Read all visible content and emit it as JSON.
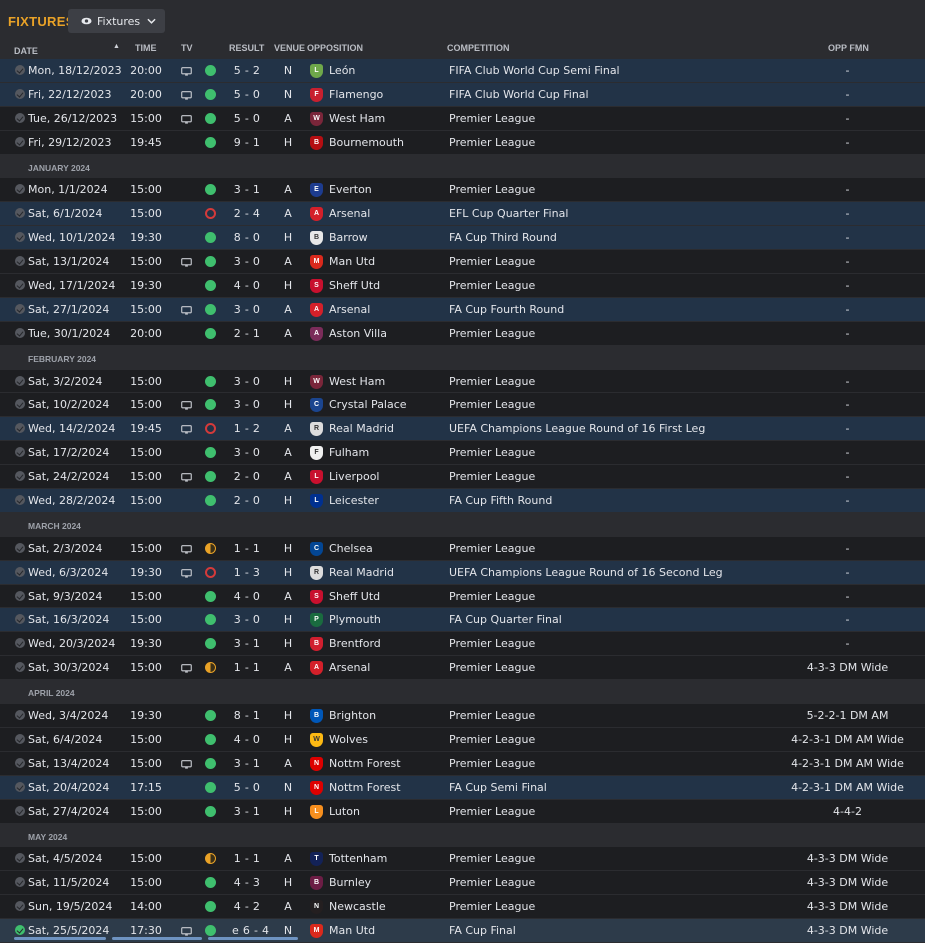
{
  "header": {
    "title": "FIXTURES",
    "view_label": "Fixtures"
  },
  "columns": {
    "date": "DATE",
    "time": "TIME",
    "tv": "TV",
    "result": "RESULT",
    "venue": "VENUE",
    "opposition": "OPPOSITION",
    "competition": "COMPETITION",
    "opp_fmn": "OPP FMN"
  },
  "colors": {
    "accent": "#e9a227",
    "win": "#3fbf6e",
    "loss": "#d43a3a",
    "draw": "#e9a227",
    "cup_row": "#223347"
  },
  "fixtures": [
    {
      "type": "match",
      "date": "Mon, 18/12/2023",
      "time": "20:00",
      "tv": true,
      "outcome": "W",
      "result": "5 - 2",
      "venue": "N",
      "opposition": "León",
      "competition": "FIFA Club World Cup Semi Final",
      "opp_fmn": "-",
      "style": "cup",
      "crest": "#6fa84a",
      "crest_text": "L"
    },
    {
      "type": "match",
      "date": "Fri, 22/12/2023",
      "time": "20:00",
      "tv": true,
      "outcome": "W",
      "result": "5 - 0",
      "venue": "N",
      "opposition": "Flamengo",
      "competition": "FIFA Club World Cup Final",
      "opp_fmn": "-",
      "style": "cup",
      "crest": "#c8202f",
      "crest_text": "F"
    },
    {
      "type": "match",
      "date": "Tue, 26/12/2023",
      "time": "15:00",
      "tv": true,
      "outcome": "W",
      "result": "5 - 0",
      "venue": "A",
      "opposition": "West Ham",
      "competition": "Premier League",
      "opp_fmn": "-",
      "style": "plain",
      "crest": "#7a263a",
      "crest_text": "W"
    },
    {
      "type": "match",
      "date": "Fri, 29/12/2023",
      "time": "19:45",
      "tv": false,
      "outcome": "W",
      "result": "9 - 1",
      "venue": "H",
      "opposition": "Bournemouth",
      "competition": "Premier League",
      "opp_fmn": "-",
      "style": "plain",
      "crest": "#b50e12",
      "crest_text": "B"
    },
    {
      "type": "month",
      "label": "JANUARY 2024"
    },
    {
      "type": "match",
      "date": "Mon, 1/1/2024",
      "time": "15:00",
      "tv": false,
      "outcome": "W",
      "result": "3 - 1",
      "venue": "A",
      "opposition": "Everton",
      "competition": "Premier League",
      "opp_fmn": "-",
      "style": "plain",
      "crest": "#1d3c8f",
      "crest_text": "E"
    },
    {
      "type": "match",
      "date": "Sat, 6/1/2024",
      "time": "15:00",
      "tv": false,
      "outcome": "L",
      "result": "2 - 4",
      "venue": "A",
      "opposition": "Arsenal",
      "competition": "EFL Cup Quarter Final",
      "opp_fmn": "-",
      "style": "cup",
      "crest": "#d4202a",
      "crest_text": "A"
    },
    {
      "type": "match",
      "date": "Wed, 10/1/2024",
      "time": "19:30",
      "tv": false,
      "outcome": "W",
      "result": "8 - 0",
      "venue": "H",
      "opposition": "Barrow",
      "competition": "FA Cup Third Round",
      "opp_fmn": "-",
      "style": "cup",
      "crest": "#e8e8e8",
      "crest_text": "B"
    },
    {
      "type": "match",
      "date": "Sat, 13/1/2024",
      "time": "15:00",
      "tv": true,
      "outcome": "W",
      "result": "3 - 0",
      "venue": "A",
      "opposition": "Man Utd",
      "competition": "Premier League",
      "opp_fmn": "-",
      "style": "plain",
      "crest": "#da291c",
      "crest_text": "M"
    },
    {
      "type": "match",
      "date": "Wed, 17/1/2024",
      "time": "19:30",
      "tv": false,
      "outcome": "W",
      "result": "4 - 0",
      "venue": "H",
      "opposition": "Sheff Utd",
      "competition": "Premier League",
      "opp_fmn": "-",
      "style": "plain",
      "crest": "#c8102e",
      "crest_text": "S"
    },
    {
      "type": "match",
      "date": "Sat, 27/1/2024",
      "time": "15:00",
      "tv": true,
      "outcome": "W",
      "result": "3 - 0",
      "venue": "A",
      "opposition": "Arsenal",
      "competition": "FA Cup Fourth Round",
      "opp_fmn": "-",
      "style": "cup",
      "crest": "#d4202a",
      "crest_text": "A"
    },
    {
      "type": "match",
      "date": "Tue, 30/1/2024",
      "time": "20:00",
      "tv": false,
      "outcome": "W",
      "result": "2 - 1",
      "venue": "A",
      "opposition": "Aston Villa",
      "competition": "Premier League",
      "opp_fmn": "-",
      "style": "plain",
      "crest": "#7b2c5a",
      "crest_text": "A"
    },
    {
      "type": "month",
      "label": "FEBRUARY 2024"
    },
    {
      "type": "match",
      "date": "Sat, 3/2/2024",
      "time": "15:00",
      "tv": false,
      "outcome": "W",
      "result": "3 - 0",
      "venue": "H",
      "opposition": "West Ham",
      "competition": "Premier League",
      "opp_fmn": "-",
      "style": "plain",
      "crest": "#7a263a",
      "crest_text": "W"
    },
    {
      "type": "match",
      "date": "Sat, 10/2/2024",
      "time": "15:00",
      "tv": true,
      "outcome": "W",
      "result": "3 - 0",
      "venue": "H",
      "opposition": "Crystal Palace",
      "competition": "Premier League",
      "opp_fmn": "-",
      "style": "plain",
      "crest": "#1b458f",
      "crest_text": "C"
    },
    {
      "type": "match",
      "date": "Wed, 14/2/2024",
      "time": "19:45",
      "tv": true,
      "outcome": "L",
      "result": "1 - 2",
      "venue": "A",
      "opposition": "Real Madrid",
      "competition": "UEFA Champions League Round of 16 First Leg",
      "opp_fmn": "-",
      "style": "cup",
      "crest": "#dcdcdc",
      "crest_text": "R"
    },
    {
      "type": "match",
      "date": "Sat, 17/2/2024",
      "time": "15:00",
      "tv": false,
      "outcome": "W",
      "result": "3 - 0",
      "venue": "A",
      "opposition": "Fulham",
      "competition": "Premier League",
      "opp_fmn": "-",
      "style": "plain",
      "crest": "#f0f0f0",
      "crest_text": "F"
    },
    {
      "type": "match",
      "date": "Sat, 24/2/2024",
      "time": "15:00",
      "tv": true,
      "outcome": "W",
      "result": "2 - 0",
      "venue": "A",
      "opposition": "Liverpool",
      "competition": "Premier League",
      "opp_fmn": "-",
      "style": "plain",
      "crest": "#c8102e",
      "crest_text": "L"
    },
    {
      "type": "match",
      "date": "Wed, 28/2/2024",
      "time": "15:00",
      "tv": false,
      "outcome": "W",
      "result": "2 - 0",
      "venue": "H",
      "opposition": "Leicester",
      "competition": "FA Cup Fifth Round",
      "opp_fmn": "-",
      "style": "cup",
      "crest": "#003090",
      "crest_text": "L"
    },
    {
      "type": "month",
      "label": "MARCH 2024"
    },
    {
      "type": "match",
      "date": "Sat, 2/3/2024",
      "time": "15:00",
      "tv": true,
      "outcome": "D",
      "result": "1 - 1",
      "venue": "H",
      "opposition": "Chelsea",
      "competition": "Premier League",
      "opp_fmn": "-",
      "style": "plain",
      "crest": "#034694",
      "crest_text": "C"
    },
    {
      "type": "match",
      "date": "Wed, 6/3/2024",
      "time": "19:30",
      "tv": true,
      "outcome": "L",
      "result": "1 - 3",
      "venue": "H",
      "opposition": "Real Madrid",
      "competition": "UEFA Champions League Round of 16 Second Leg",
      "opp_fmn": "-",
      "style": "cup",
      "crest": "#dcdcdc",
      "crest_text": "R"
    },
    {
      "type": "match",
      "date": "Sat, 9/3/2024",
      "time": "15:00",
      "tv": false,
      "outcome": "W",
      "result": "4 - 0",
      "venue": "A",
      "opposition": "Sheff Utd",
      "competition": "Premier League",
      "opp_fmn": "-",
      "style": "plain",
      "crest": "#c8102e",
      "crest_text": "S"
    },
    {
      "type": "match",
      "date": "Sat, 16/3/2024",
      "time": "15:00",
      "tv": false,
      "outcome": "W",
      "result": "3 - 0",
      "venue": "H",
      "opposition": "Plymouth",
      "competition": "FA Cup Quarter Final",
      "opp_fmn": "-",
      "style": "cup",
      "crest": "#1a6b3f",
      "crest_text": "P"
    },
    {
      "type": "match",
      "date": "Wed, 20/3/2024",
      "time": "19:30",
      "tv": false,
      "outcome": "W",
      "result": "3 - 1",
      "venue": "H",
      "opposition": "Brentford",
      "competition": "Premier League",
      "opp_fmn": "-",
      "style": "plain",
      "crest": "#d11f2f",
      "crest_text": "B"
    },
    {
      "type": "match",
      "date": "Sat, 30/3/2024",
      "time": "15:00",
      "tv": true,
      "outcome": "D",
      "result": "1 - 1",
      "venue": "A",
      "opposition": "Arsenal",
      "competition": "Premier League",
      "opp_fmn": "4-3-3 DM Wide",
      "style": "plain",
      "crest": "#d4202a",
      "crest_text": "A"
    },
    {
      "type": "month",
      "label": "APRIL 2024"
    },
    {
      "type": "match",
      "date": "Wed, 3/4/2024",
      "time": "19:30",
      "tv": false,
      "outcome": "W",
      "result": "8 - 1",
      "venue": "H",
      "opposition": "Brighton",
      "competition": "Premier League",
      "opp_fmn": "5-2-2-1 DM AM",
      "style": "plain",
      "crest": "#0057b8",
      "crest_text": "B"
    },
    {
      "type": "match",
      "date": "Sat, 6/4/2024",
      "time": "15:00",
      "tv": false,
      "outcome": "W",
      "result": "4 - 0",
      "venue": "H",
      "opposition": "Wolves",
      "competition": "Premier League",
      "opp_fmn": "4-2-3-1 DM AM Wide",
      "style": "plain",
      "crest": "#fdb913",
      "crest_text": "W"
    },
    {
      "type": "match",
      "date": "Sat, 13/4/2024",
      "time": "15:00",
      "tv": true,
      "outcome": "W",
      "result": "3 - 1",
      "venue": "A",
      "opposition": "Nottm Forest",
      "competition": "Premier League",
      "opp_fmn": "4-2-3-1 DM AM Wide",
      "style": "plain",
      "crest": "#dd0000",
      "crest_text": "N"
    },
    {
      "type": "match",
      "date": "Sat, 20/4/2024",
      "time": "17:15",
      "tv": false,
      "outcome": "W",
      "result": "5 - 0",
      "venue": "N",
      "opposition": "Nottm Forest",
      "competition": "FA Cup Semi Final",
      "opp_fmn": "4-2-3-1 DM AM Wide",
      "style": "cup",
      "crest": "#dd0000",
      "crest_text": "N"
    },
    {
      "type": "match",
      "date": "Sat, 27/4/2024",
      "time": "15:00",
      "tv": false,
      "outcome": "W",
      "result": "3 - 1",
      "venue": "H",
      "opposition": "Luton",
      "competition": "Premier League",
      "opp_fmn": "4-4-2",
      "style": "plain",
      "crest": "#f78f1e",
      "crest_text": "L"
    },
    {
      "type": "month",
      "label": "MAY 2024"
    },
    {
      "type": "match",
      "date": "Sat, 4/5/2024",
      "time": "15:00",
      "tv": false,
      "outcome": "D",
      "result": "1 - 1",
      "venue": "A",
      "opposition": "Tottenham",
      "competition": "Premier League",
      "opp_fmn": "4-3-3 DM Wide",
      "style": "plain",
      "crest": "#132257",
      "crest_text": "T"
    },
    {
      "type": "match",
      "date": "Sat, 11/5/2024",
      "time": "15:00",
      "tv": false,
      "outcome": "W",
      "result": "4 - 3",
      "venue": "H",
      "opposition": "Burnley",
      "competition": "Premier League",
      "opp_fmn": "4-3-3 DM Wide",
      "style": "plain",
      "crest": "#6c1d45",
      "crest_text": "B"
    },
    {
      "type": "match",
      "date": "Sun, 19/5/2024",
      "time": "14:00",
      "tv": false,
      "outcome": "W",
      "result": "4 - 2",
      "venue": "A",
      "opposition": "Newcastle",
      "competition": "Premier League",
      "opp_fmn": "4-3-3 DM Wide",
      "style": "plain",
      "crest": "#241f20",
      "crest_text": "N"
    },
    {
      "type": "match",
      "date": "Sat, 25/5/2024",
      "time": "17:30",
      "tv": true,
      "outcome": "W",
      "result": "e 6 - 4",
      "venue": "N",
      "opposition": "Man Utd",
      "competition": "FA Cup Final",
      "opp_fmn": "4-3-3 DM Wide",
      "style": "sel",
      "crest": "#da291c",
      "crest_text": "M",
      "checked": true
    }
  ]
}
